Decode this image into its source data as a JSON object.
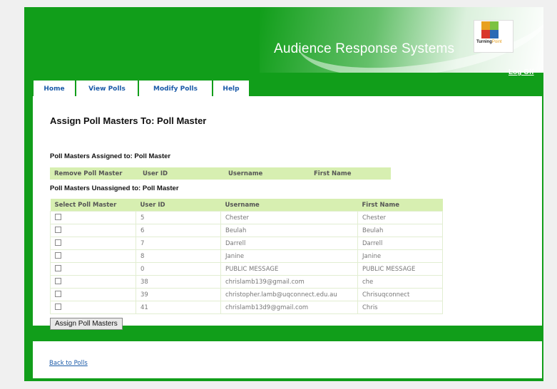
{
  "header": {
    "brand": "Audience Response Systems",
    "logo_text": "Turning",
    "logo_text_suffix": "Point",
    "logoff": "Log Off"
  },
  "tabs": [
    "Home",
    "View Polls",
    "Modify Polls",
    "Help"
  ],
  "page_title": "Assign Poll Masters To: Poll Master",
  "assigned": {
    "title": "Poll Masters Assigned to: Poll Master",
    "headers": [
      "Remove Poll Master",
      "User ID",
      "Username",
      "First Name"
    ]
  },
  "unassigned": {
    "title": "Poll Masters Unassigned to: Poll Master",
    "headers": [
      "Select Poll Master",
      "User ID",
      "Username",
      "First Name"
    ],
    "rows": [
      [
        "5",
        "Chester",
        "Chester"
      ],
      [
        "6",
        "Beulah",
        "Beulah"
      ],
      [
        "7",
        "Darrell",
        "Darrell"
      ],
      [
        "8",
        "Janine",
        "Janine"
      ],
      [
        "0",
        "PUBLIC MESSAGE",
        "PUBLIC MESSAGE"
      ],
      [
        "38",
        "chrislamb139@gmail.com",
        "che"
      ],
      [
        "39",
        "christopher.lamb@uqconnect.edu.au",
        "Chrisuqconnect"
      ],
      [
        "41",
        "chrislamb13d9@gmail.com",
        "Chris"
      ]
    ]
  },
  "assign_button": "Assign Poll Masters",
  "back_link": "Back to Polls",
  "colors": {
    "green": "#119e1a",
    "header_row": "#d7efb1",
    "link": "#1a5aa8"
  }
}
